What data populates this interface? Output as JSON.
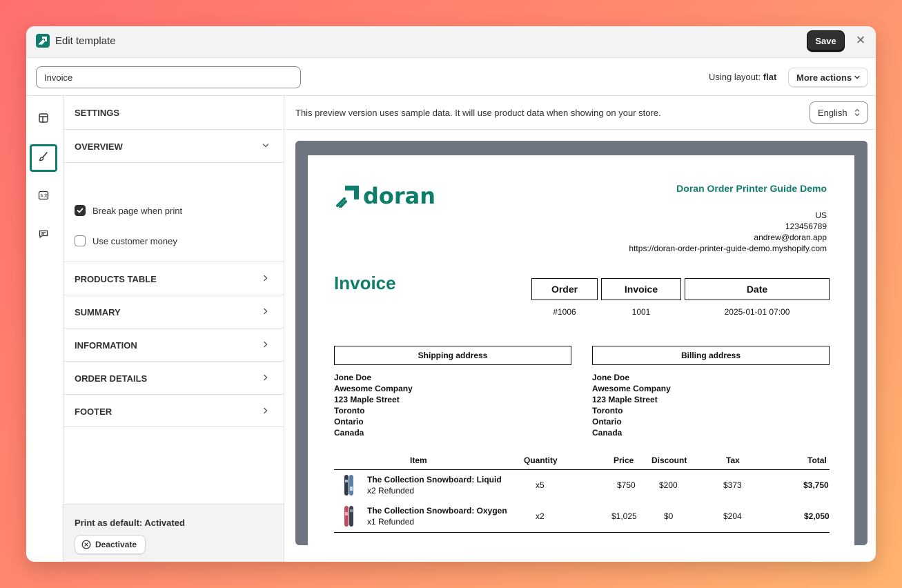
{
  "window": {
    "title": "Edit template"
  },
  "toolbar": {
    "save_label": "Save",
    "template_name": "Invoice",
    "layout_prefix": "Using layout:",
    "layout_value": "flat",
    "more_actions_label": "More actions"
  },
  "rail": {
    "items": [
      {
        "name": "layout-icon",
        "active": false
      },
      {
        "name": "brush-icon",
        "active": true
      },
      {
        "name": "translate-icon",
        "active": false
      },
      {
        "name": "chat-icon",
        "active": false
      }
    ]
  },
  "settings": {
    "heading": "SETTINGS",
    "overview_label": "OVERVIEW",
    "options": [
      {
        "label": "Break page when print",
        "checked": true
      },
      {
        "label": "Use customer money",
        "checked": false
      }
    ],
    "sections": [
      "PRODUCTS TABLE",
      "SUMMARY",
      "INFORMATION",
      "ORDER DETAILS",
      "FOOTER"
    ],
    "print_default": "Print as default: Activated",
    "deactivate_label": "Deactivate"
  },
  "preview": {
    "note": "This preview version uses sample data. It will use product data when showing on your store.",
    "language": "English"
  },
  "invoice": {
    "brand": "doran",
    "shop_name": "Doran Order Printer Guide Demo",
    "shop_lines": [
      "US",
      "123456789",
      "andrew@doran.app",
      "https://doran-order-printer-guide-demo.myshopify.com"
    ],
    "title": "Invoice",
    "meta_headers": [
      "Order",
      "Invoice",
      "Date"
    ],
    "meta_values": [
      "#1006",
      "1001",
      "2025-01-01 07:00"
    ],
    "shipping_heading": "Shipping address",
    "billing_heading": "Billing address",
    "shipping_lines": [
      "Jone Doe",
      "Awesome Company",
      "123 Maple Street",
      "Toronto",
      "Ontario",
      "Canada"
    ],
    "billing_lines": [
      "Jone Doe",
      "Awesome Company",
      "123 Maple Street",
      "Toronto",
      "Ontario",
      "Canada"
    ],
    "table_headers": [
      "Item",
      "Quantity",
      "Price",
      "Discount",
      "Tax",
      "Total"
    ],
    "rows": [
      {
        "name": "The Collection Snowboard: Liquid",
        "sub": "x2 Refunded",
        "qty": "x5",
        "price": "$750",
        "discount": "$200",
        "tax": "$373",
        "total": "$3,750"
      },
      {
        "name": "The Collection Snowboard: Oxygen",
        "sub": "x1 Refunded",
        "qty": "x2",
        "price": "$1,025",
        "discount": "$0",
        "tax": "$204",
        "total": "$2,050"
      }
    ]
  },
  "colors": {
    "brand": "#0f7d6b",
    "canvas": "#6f7580"
  }
}
